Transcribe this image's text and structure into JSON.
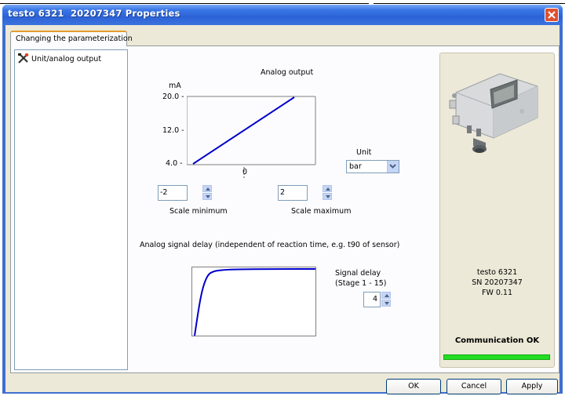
{
  "window": {
    "title": "testo 6321  20207347 Properties"
  },
  "tabs": [
    {
      "label": "Changing the parameterization"
    }
  ],
  "tree": {
    "items": [
      {
        "label": "Unit/analog output",
        "icon": "tools-icon"
      }
    ]
  },
  "analog_output": {
    "title": "Analog output",
    "y_unit": "mA",
    "y_ticks": [
      "20.0 -",
      "12.0 -",
      "4.0 -"
    ],
    "x_mid_tick": "0",
    "scale_min_value": "-2",
    "scale_max_value": "2",
    "scale_min_label": "Scale minimum",
    "scale_max_label": "Scale maximum",
    "line_color": "#0000cc"
  },
  "unit": {
    "label": "Unit",
    "selected": "bar"
  },
  "signal_delay": {
    "section_title": "Analog signal delay (independent of reaction time, e.g. t90 of sensor)",
    "label_line1": "Signal delay",
    "label_line2": "(Stage 1 - 15)",
    "value": "4"
  },
  "device": {
    "model": "testo 6321",
    "serial": "SN 20207347",
    "firmware": "FW  0.11",
    "status": "Communication OK",
    "status_color": "#22dd22"
  },
  "buttons": {
    "ok": "OK",
    "cancel": "Cancel",
    "apply": "Apply"
  }
}
